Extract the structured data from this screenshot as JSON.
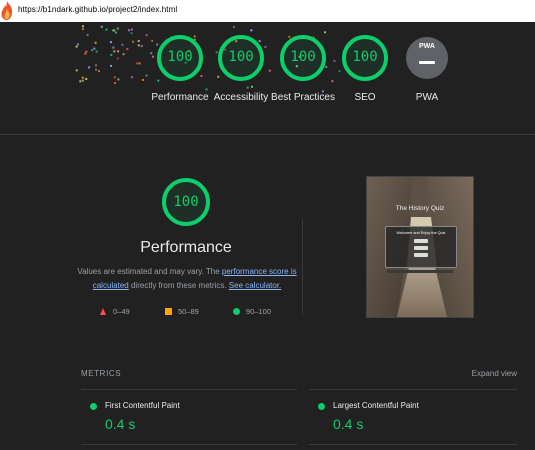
{
  "browser": {
    "url": "https://b1ndark.github.io/project2/index.html",
    "favicon_icon": "flame-icon"
  },
  "categories": [
    {
      "key": "performance",
      "label": "Performance",
      "score": "100"
    },
    {
      "key": "accessibility",
      "label": "Accessibility",
      "score": "100"
    },
    {
      "key": "best_practices",
      "label": "Best Practices",
      "score": "100"
    },
    {
      "key": "seo",
      "label": "SEO",
      "score": "100"
    }
  ],
  "pwa": {
    "badge": "PWA",
    "label": "PWA"
  },
  "performance": {
    "score": "100",
    "title": "Performance",
    "note_prefix": "Values are estimated and may vary. The ",
    "note_link1": "performance score is calculated",
    "note_middle": " directly from these metrics. ",
    "note_link2": "See calculator."
  },
  "legend": [
    {
      "range": "0–49",
      "icon": "triangle-icon",
      "color": "#ff4e42"
    },
    {
      "range": "50–89",
      "icon": "square-icon",
      "color": "#ffa400"
    },
    {
      "range": "90–100",
      "icon": "circle-icon",
      "color": "#0cce6b"
    }
  ],
  "screenshot": {
    "title": "The History Quiz",
    "welcome": "Welcome and Enjoy the Quiz"
  },
  "metrics": {
    "header": "METRICS",
    "expand": "Expand view",
    "items": [
      {
        "name": "First Contentful Paint",
        "value": "0.4 s"
      },
      {
        "name": "Largest Contentful Paint",
        "value": "0.4 s"
      }
    ]
  },
  "colors": {
    "pass": "#0cce6b",
    "average": "#ffa400",
    "fail": "#ff4e42",
    "link": "#8ab4f8",
    "background": "#212121"
  }
}
